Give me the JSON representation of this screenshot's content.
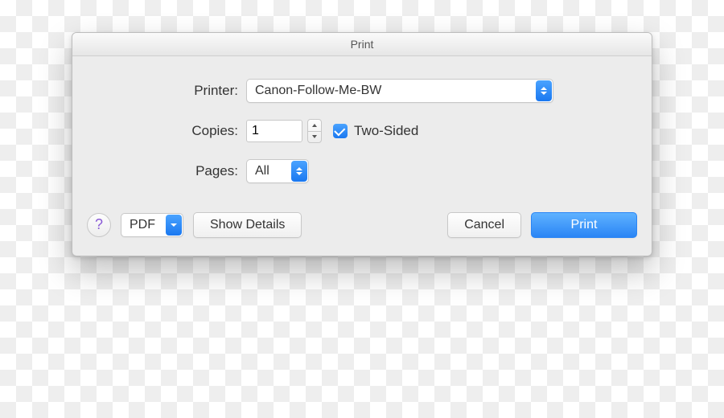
{
  "dialog": {
    "title": "Print",
    "printer": {
      "label": "Printer:",
      "selected": "Canon-Follow-Me-BW"
    },
    "copies": {
      "label": "Copies:",
      "value": "1",
      "two_sided_checked": true,
      "two_sided_label": "Two-Sided"
    },
    "pages": {
      "label": "Pages:",
      "selected": "All"
    }
  },
  "footer": {
    "help_symbol": "?",
    "pdf_label": "PDF",
    "show_details_label": "Show Details",
    "cancel_label": "Cancel",
    "print_label": "Print"
  }
}
